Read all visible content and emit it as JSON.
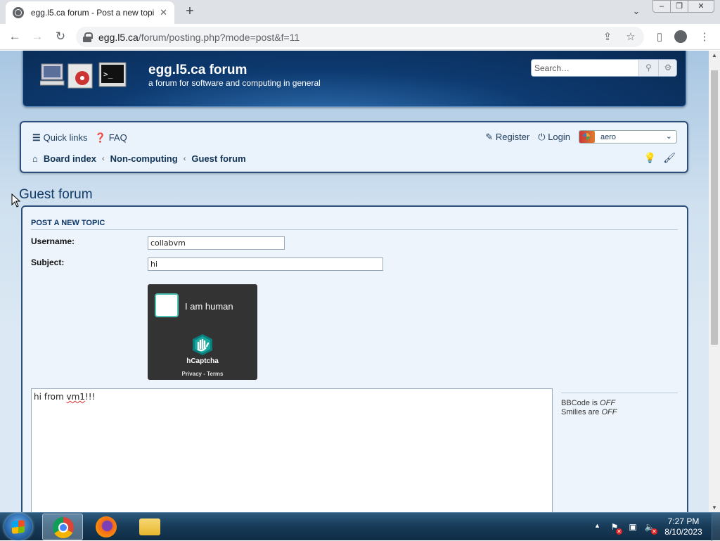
{
  "browser": {
    "tab_title": "egg.l5.ca forum - Post a new topic",
    "tab_close": "✕",
    "new_tab": "+",
    "url_host": "egg.l5.ca",
    "url_path": "/forum/posting.php?mode=post&f=11",
    "window_controls": [
      "minimize",
      "maximize",
      "close"
    ]
  },
  "site": {
    "name": "egg.l5.ca forum",
    "description": "a forum for software and computing in general",
    "search_placeholder": "Search…"
  },
  "navbar": {
    "quick_links": "Quick links",
    "faq": "FAQ",
    "register": "Register",
    "login": "Login",
    "style_value": "aero",
    "breadcrumbs": [
      "Board index",
      "Non-computing",
      "Guest forum"
    ]
  },
  "forum": {
    "title": "Guest forum"
  },
  "post_form": {
    "heading": "POST A NEW TOPIC",
    "username_label": "Username:",
    "username_value": "collabvm",
    "subject_label": "Subject:",
    "subject_value": "hi",
    "captcha": {
      "checkbox_label": "I am human",
      "brand": "hCaptcha",
      "links": "Privacy - Terms"
    },
    "message_prefix": "hi from ",
    "message_misspelled": "vm1",
    "message_suffix": "!!!",
    "bbcode_label": "BBCode is",
    "bbcode_state": "OFF",
    "smilies_label": "Smilies are",
    "smilies_state": "OFF"
  },
  "taskbar": {
    "apps": [
      "chrome",
      "firefox",
      "file-explorer"
    ],
    "time": "7:27 PM",
    "date": "8/10/2023"
  },
  "colors": {
    "banner": "#0d3a70",
    "panel_border": "#2b4f7a",
    "panel_bg": "#eef4fb",
    "link": "#123456",
    "captcha_bg": "#333333",
    "captcha_accent": "#4dc4b5"
  }
}
